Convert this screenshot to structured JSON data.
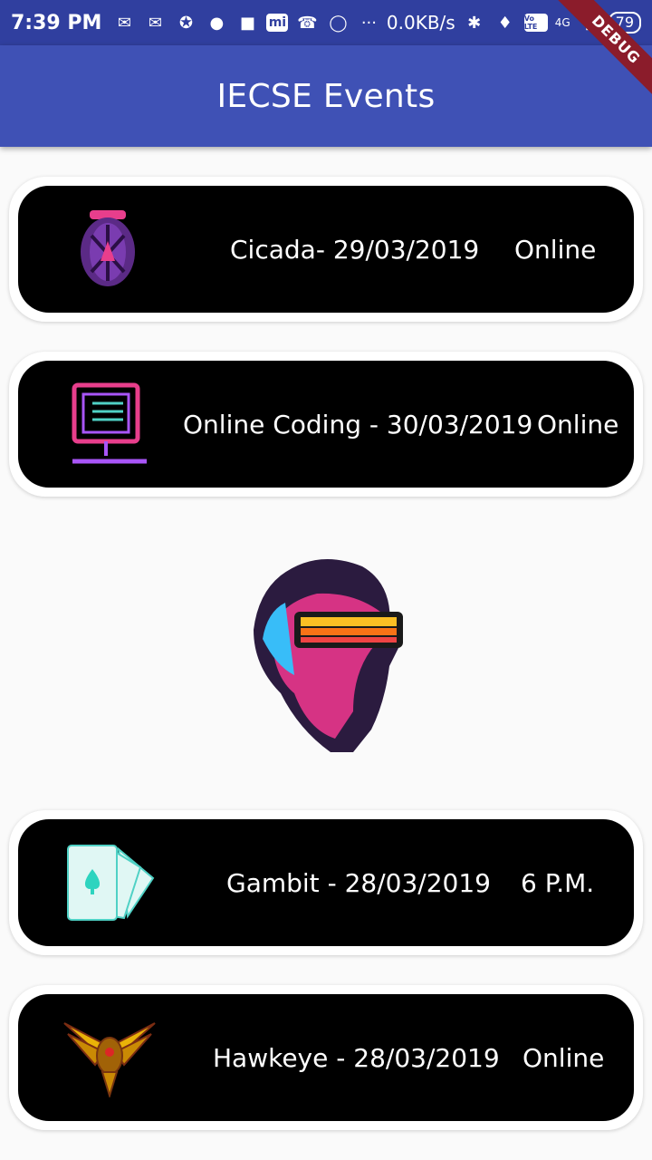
{
  "status_bar": {
    "time": "7:39 PM",
    "net_speed": "0.0KB/s",
    "network": "4G",
    "volte": "Vo LTE",
    "battery": "79",
    "mi_label": "mi",
    "icons": [
      "message-icon",
      "message-icon",
      "myntra-icon",
      "snapchat-icon",
      "robot-icon",
      "mi-icon",
      "phone-icon",
      "whatsapp-icon",
      "bluetooth-icon",
      "mute-icon",
      "signal-icon"
    ]
  },
  "app_bar": {
    "title": "IECSE Events"
  },
  "debug_banner": "DEBUG",
  "events": [
    {
      "title": "Cicada- 29/03/2019",
      "when": "Online",
      "icon": "cicada-icon"
    },
    {
      "title": "Online Coding - 30/03/2019",
      "when": "Online",
      "icon": "coding-monitor-icon"
    },
    {
      "title": "Gambit - 28/03/2019",
      "when": "6 P.M.",
      "icon": "playing-cards-icon"
    },
    {
      "title": "Hawkeye - 28/03/2019",
      "when": "Online",
      "icon": "hawk-emblem-icon"
    }
  ],
  "colors": {
    "status_bar": "#303f9f",
    "app_bar": "#3f51b5",
    "card": "#000000",
    "background": "#fafafa"
  }
}
